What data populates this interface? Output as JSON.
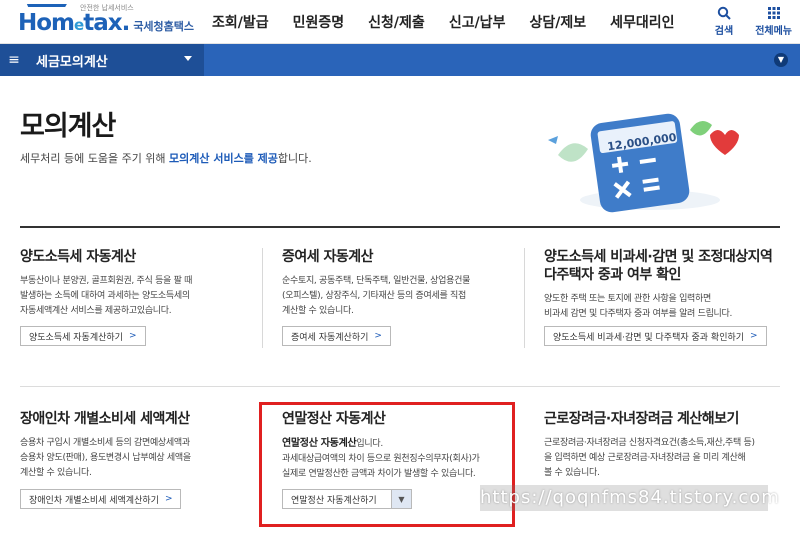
{
  "header": {
    "logo_main_1": "Hom",
    "logo_main_e": "e",
    "logo_main_2": "tax.",
    "logo_sub": "국세청홈택스",
    "logo_mini": "안전한 납세서비스",
    "gnb": [
      "조회/발급",
      "민원증명",
      "신청/제출",
      "신고/납부",
      "상담/제보",
      "세무대리인"
    ],
    "search_label": "검색",
    "menu_label": "전체메뉴"
  },
  "navbar": {
    "title": "세금모의계산"
  },
  "hero": {
    "title": "모의계산",
    "desc_prefix": "세무처리 등에 도움을 주기 위해 ",
    "desc_highlight": "모의계산 서비스를 제공",
    "desc_suffix": "합니다.",
    "calc_display": "12,000,000"
  },
  "cards": {
    "c1": {
      "title": "양도소득세 자동계산",
      "lines": [
        "부동산이나 분양권, 골프회원권, 주식 등을 팔 때",
        "발생하는 소득에 대하여 과세하는 양도소득세의",
        "자동세액계산 서비스를 제공하고있습니다."
      ],
      "button": "양도소득세 자동계산하기"
    },
    "c2": {
      "title": "증여세 자동계산",
      "lines": [
        "순수토지, 공동주택, 단독주택, 일반건물, 상업용건물",
        "(오피스텔), 상장주식, 기타재산 등의 증여세를 직접",
        "계산할 수 있습니다."
      ],
      "button": "증여세 자동계산하기"
    },
    "c3": {
      "title_1": "양도소득세 비과세·감면 및 조정대상지역",
      "title_2": "다주택자 중과 여부 확인",
      "lines": [
        "양도한 주택 또는 토지에 관한 사항을 입력하면",
        "비과세 감면 및 다주택자 중과 여부를 알려 드립니다."
      ],
      "button": "양도소득세 비과세·감면 및 다주택자 중과 확인하기"
    },
    "c4": {
      "title": "장애인차 개별소비세 세액계산",
      "lines": [
        "승용차 구입시 개별소비세 등의 감면예상세액과",
        "승용차 양도(판매), 용도변경시 납부예상 세액을",
        "계산할 수 있습니다."
      ],
      "button": "장애인차 개별소비세 세액계산하기"
    },
    "c5": {
      "title": "연말정산 자동계산",
      "strong": "연말정산 자동계산",
      "strong_suffix": "입니다.",
      "lines": [
        "과세대상급여액의 차이 등으로 원천징수의무자(회사)가",
        "실제로 연말정산한 금액과 차이가 발생할 수 있습니다."
      ],
      "button": "연말정산 자동계산하기"
    },
    "c6": {
      "title": "근로장려금·자녀장려금 계산해보기",
      "lines": [
        "근로장려금·자녀장려금 신청자격요건(총소득,재산,주택 등)",
        "을 입력하면 예상 근로장려금·자녀장려금 을 미리 계산해",
        "볼 수 있습니다."
      ]
    }
  },
  "watermark": "https://qoqnfms84.tistory.com"
}
